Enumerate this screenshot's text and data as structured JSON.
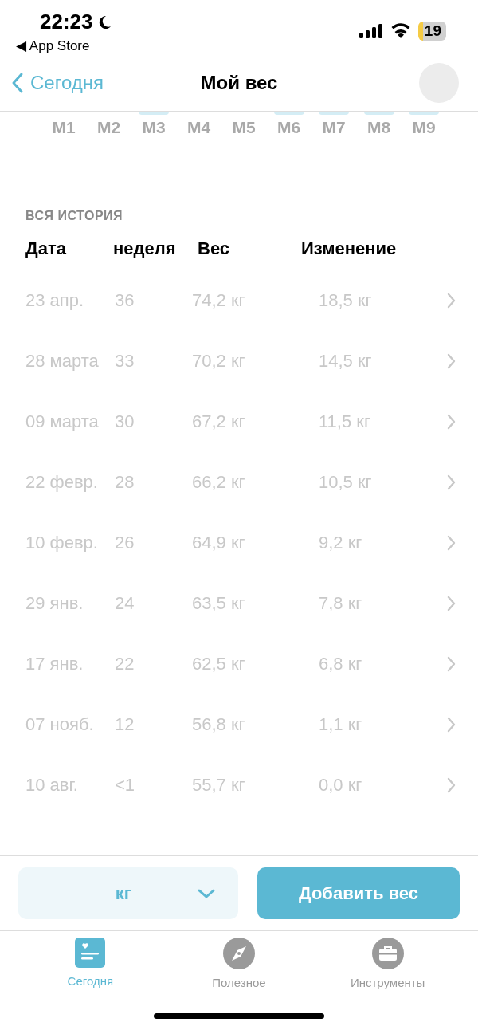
{
  "status_bar": {
    "time": "22:23",
    "back_app": "◀ App Store",
    "battery": "19"
  },
  "nav": {
    "back": "Сегодня",
    "title": "Мой вес"
  },
  "months": [
    {
      "label": "M1",
      "bar": false
    },
    {
      "label": "M2",
      "bar": false
    },
    {
      "label": "M3",
      "bar": true
    },
    {
      "label": "M4",
      "bar": false
    },
    {
      "label": "M5",
      "bar": false
    },
    {
      "label": "M6",
      "bar": true
    },
    {
      "label": "M7",
      "bar": true
    },
    {
      "label": "M8",
      "bar": true
    },
    {
      "label": "M9",
      "bar": true
    }
  ],
  "history": {
    "title": "ВСЯ ИСТОРИЯ",
    "columns": [
      "Дата",
      "неделя",
      "Вес",
      "Изменение"
    ],
    "rows": [
      [
        "23 апр.",
        "36",
        "74,2 кг",
        "18,5 кг"
      ],
      [
        "28 марта",
        "33",
        "70,2 кг",
        "14,5 кг"
      ],
      [
        "09 марта",
        "30",
        "67,2 кг",
        "11,5 кг"
      ],
      [
        "22 февр.",
        "28",
        "66,2 кг",
        "10,5 кг"
      ],
      [
        "10 февр.",
        "26",
        "64,9 кг",
        "9,2 кг"
      ],
      [
        "29 янв.",
        "24",
        "63,5 кг",
        "7,8 кг"
      ],
      [
        "17 янв.",
        "22",
        "62,5 кг",
        "6,8 кг"
      ],
      [
        "07 нояб.",
        "12",
        "56,8 кг",
        "1,1 кг"
      ],
      [
        "10 авг.",
        "<1",
        "55,7 кг",
        "0,0 кг"
      ]
    ]
  },
  "unit_select": {
    "value": "кг"
  },
  "add_button": "Добавить вес",
  "tabs": [
    {
      "label": "Сегодня",
      "kind": "today",
      "selected": true
    },
    {
      "label": "Полезное",
      "kind": "compass",
      "selected": false
    },
    {
      "label": "Инструменты",
      "kind": "toolbox",
      "selected": false
    }
  ]
}
